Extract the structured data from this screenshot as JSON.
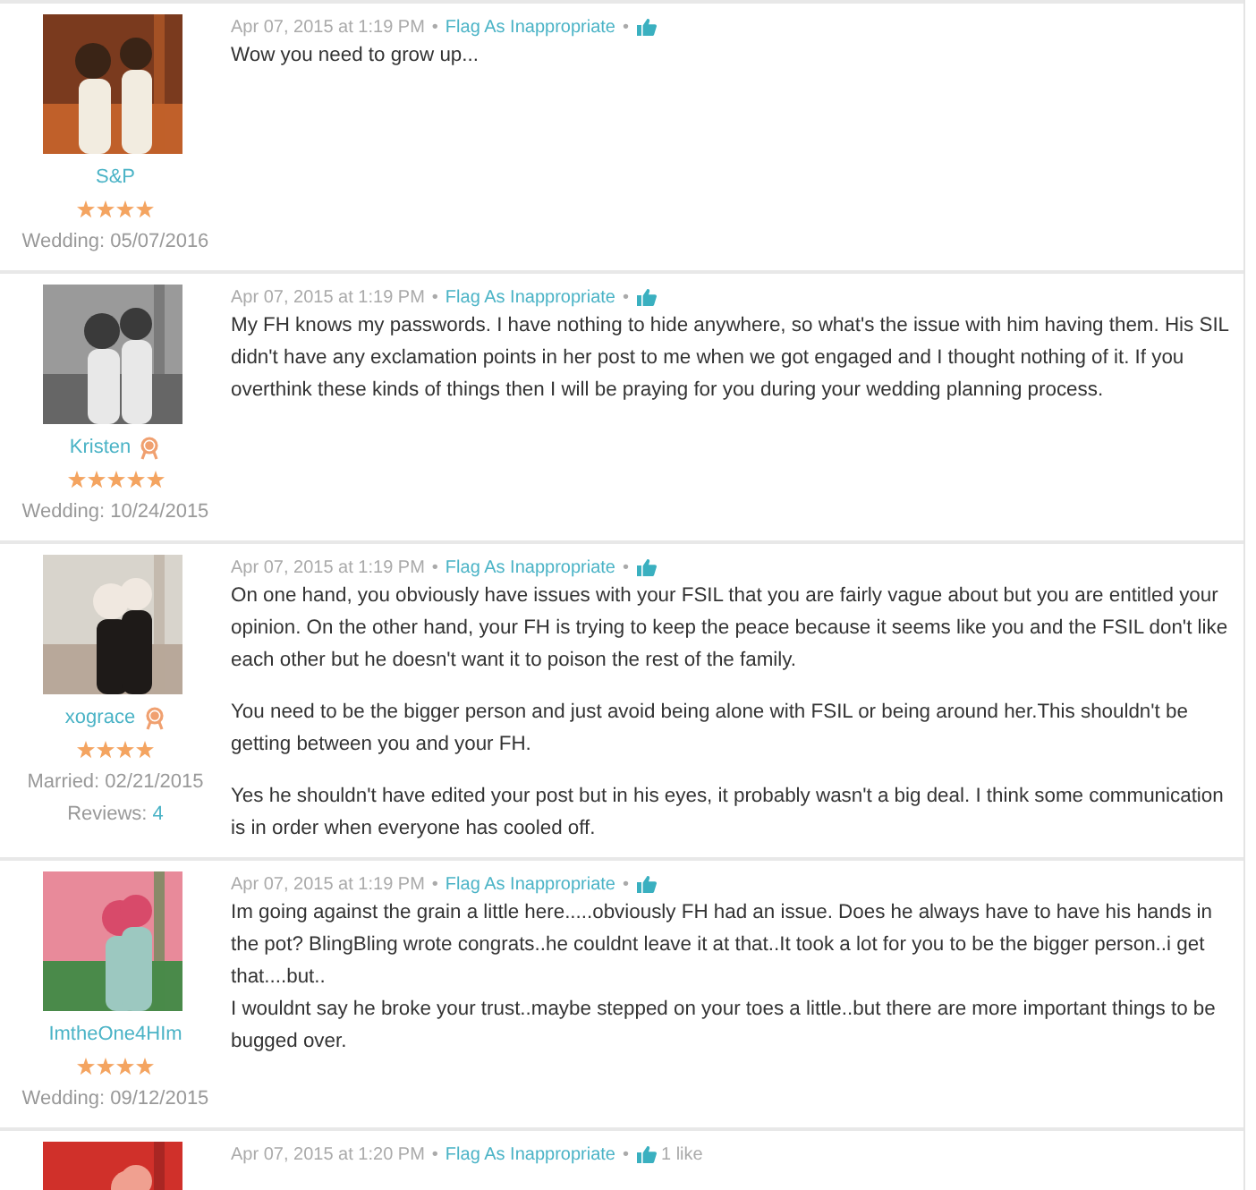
{
  "posts": [
    {
      "author": "S&P",
      "badge": false,
      "stars": 4,
      "info": [
        "Wedding: 05/07/2016"
      ],
      "avatar": {
        "kind": "picture"
      },
      "date": "Apr 07, 2015 at 1:19 PM",
      "separators": [
        "•",
        "•"
      ],
      "flag": "Flag As Inappropriate",
      "paragraphs": [
        "Wow you need to grow up..."
      ]
    },
    {
      "author": "Kristen",
      "badge": true,
      "stars": 5,
      "info": [
        "Wedding: 10/24/2015"
      ],
      "avatar": {
        "kind": "picture"
      },
      "date": "Apr 07, 2015 at 1:19 PM",
      "separators": [
        "•",
        "•"
      ],
      "flag": "Flag As Inappropriate",
      "paragraphs": [
        "My FH knows my passwords. I have nothing to hide anywhere, so what's the issue with him having them. His SIL didn't have any exclamation points in her post to me when we got engaged and I thought nothing of it. If you overthink these kinds of things then I will be praying for you during your wedding planning process."
      ]
    },
    {
      "author": "xograce",
      "badge": true,
      "stars": 4,
      "info": [
        "Married: 02/21/2015"
      ],
      "reviews": {
        "label": "Reviews:",
        "count": "4"
      },
      "avatar": {
        "kind": "picture"
      },
      "date": "Apr 07, 2015 at 1:19 PM",
      "separators": [
        "•",
        "•"
      ],
      "flag": "Flag As Inappropriate",
      "paragraphs": [
        "On one hand, you obviously have issues with your FSIL that you are fairly vague about but you are entitled your opinion. On the other hand, your FH is trying to keep the peace because it seems like you and the FSIL don't like each other but he doesn't want it to poison the rest of the family.",
        "You need to be the bigger person and just avoid being alone with FSIL or being around her.This shouldn't be getting between you and your FH.",
        "Yes he shouldn't have edited your post but in his eyes, it probably wasn't a big deal. I think some communication is in order when everyone has cooled off."
      ]
    },
    {
      "author": "ImtheOne4HIm",
      "badge": false,
      "stars": 4,
      "info": [
        "Wedding: 09/12/2015"
      ],
      "avatar": {
        "kind": "picture"
      },
      "date": "Apr 07, 2015 at 1:19 PM",
      "separators": [
        "•",
        "•"
      ],
      "flag": "Flag As Inappropriate",
      "paragraphs": [
        "Im going against the grain a little here.....obviously FH had an issue. Does he always have to have his hands in the pot? BlingBling wrote congrats..he couldnt leave it at that..It took a lot for you to be the bigger person..i get that....but..\nI wouldnt say he broke your trust..maybe stepped on your toes a little..but there are more important things to be bugged over."
      ]
    },
    {
      "avatar": {
        "kind": "picture"
      },
      "date": "Apr 07, 2015 at 1:20 PM",
      "separators": [
        "•",
        "•"
      ],
      "flag": "Flag As Inappropriate",
      "likes": "1 like"
    }
  ]
}
